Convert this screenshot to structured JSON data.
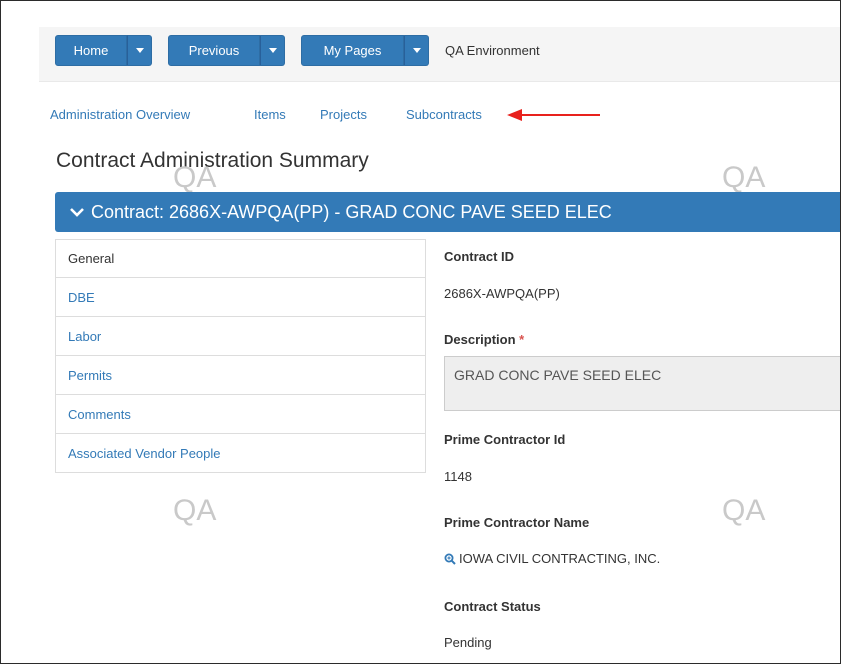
{
  "toolbar": {
    "home_label": "Home",
    "previous_label": "Previous",
    "my_pages_label": "My Pages",
    "environment_label": "QA Environment"
  },
  "subnav": {
    "items": [
      "Administration Overview",
      "Items",
      "Projects",
      "Subcontracts"
    ]
  },
  "page_title": "Contract Administration Summary",
  "watermark_text": "QA",
  "contract_header": "Contract: 2686X-AWPQA(PP) - GRAD CONC PAVE SEED ELEC",
  "side_menu": {
    "items": [
      "General",
      "DBE",
      "Labor",
      "Permits",
      "Comments",
      "Associated Vendor People"
    ]
  },
  "details": {
    "contract_id_label": "Contract ID",
    "contract_id_value": "2686X-AWPQA(PP)",
    "description_label": "Description",
    "required_marker": "*",
    "description_value": "GRAD CONC PAVE SEED ELEC",
    "prime_contractor_id_label": "Prime Contractor Id",
    "prime_contractor_id_value": "1148",
    "prime_contractor_name_label": "Prime Contractor Name",
    "prime_contractor_name_value": "IOWA CIVIL CONTRACTING, INC.",
    "contract_status_label": "Contract Status",
    "contract_status_value": "Pending"
  },
  "colors": {
    "primary": "#337ab7",
    "arrow": "#e8211d",
    "watermark": "#c9c9c9"
  },
  "icons": {
    "caret": "caret-down-icon",
    "chevron": "chevron-down-icon",
    "search": "magnifier-icon"
  }
}
